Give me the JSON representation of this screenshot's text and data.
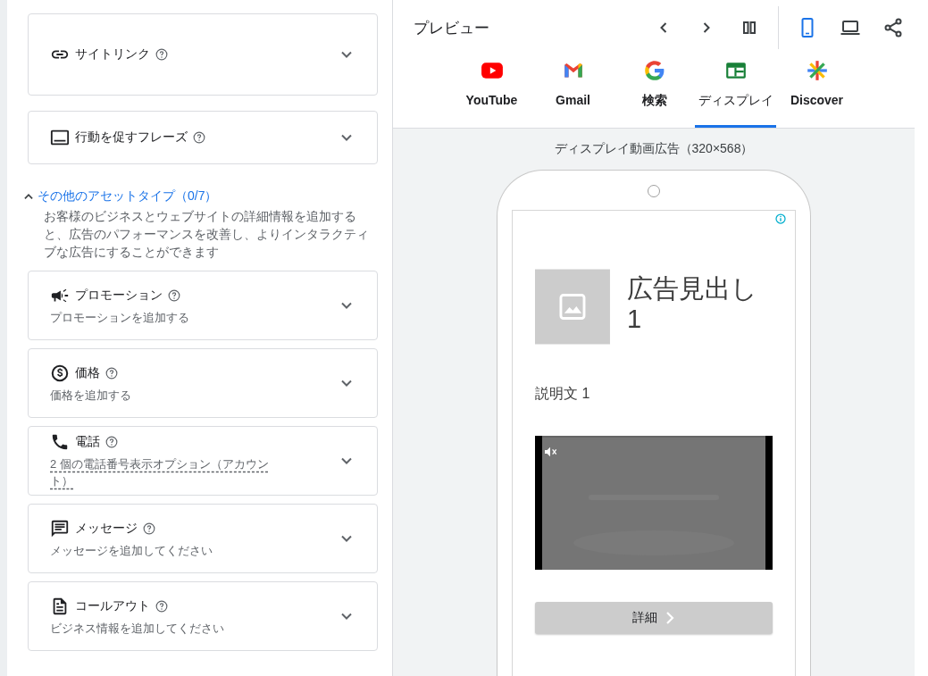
{
  "top_cards": [
    {
      "kind": "link",
      "title": "サイトリンク",
      "expanded": false
    },
    {
      "kind": "cta",
      "title": "行動を促すフレーズ",
      "expanded": false
    }
  ],
  "other_assets": {
    "label": "その他のアセットタイプ（0/7）",
    "expanded": true,
    "description": "お客様のビジネスとウェブサイトの詳細情報を追加すると、広告のパフォーマンスを改善し、よりインタラクティブな広告にすることができます"
  },
  "other_cards": [
    {
      "kind": "promotion",
      "title": "プロモーション",
      "subtitle": "プロモーションを追加する",
      "subtitle_dashed": false,
      "expanded": false
    },
    {
      "kind": "price",
      "title": "価格",
      "subtitle": "価格を追加する",
      "subtitle_dashed": false,
      "expanded": false
    },
    {
      "kind": "phone",
      "title": "電話",
      "subtitle": "2 個の電話番号表示オプション（アカウント）",
      "subtitle_dashed": true,
      "expanded": false
    },
    {
      "kind": "message",
      "title": "メッセージ",
      "subtitle": "メッセージを追加してください",
      "subtitle_dashed": false,
      "expanded": false
    },
    {
      "kind": "callout",
      "title": "コールアウト",
      "subtitle": "ビジネス情報を追加してください",
      "subtitle_dashed": false,
      "expanded": false
    }
  ],
  "preview": {
    "title": "プレビュー",
    "devices": [
      {
        "kind": "mobile",
        "selected": true
      },
      {
        "kind": "desktop",
        "selected": false
      }
    ],
    "tabs": [
      {
        "kind": "youtube",
        "label": "YouTube",
        "selected": false
      },
      {
        "kind": "gmail",
        "label": "Gmail",
        "selected": false
      },
      {
        "kind": "search",
        "label": "検索",
        "selected": false
      },
      {
        "kind": "display",
        "label": "ディスプレイ",
        "selected": true
      },
      {
        "kind": "discover",
        "label": "Discover",
        "selected": false
      }
    ],
    "format_label": "ディスプレイ動画広告（320×568）",
    "ad": {
      "headline": "広告見出し 1",
      "description": "説明文 1",
      "video": {
        "kind": "picture",
        "muted": true
      },
      "button": "詳細"
    }
  }
}
